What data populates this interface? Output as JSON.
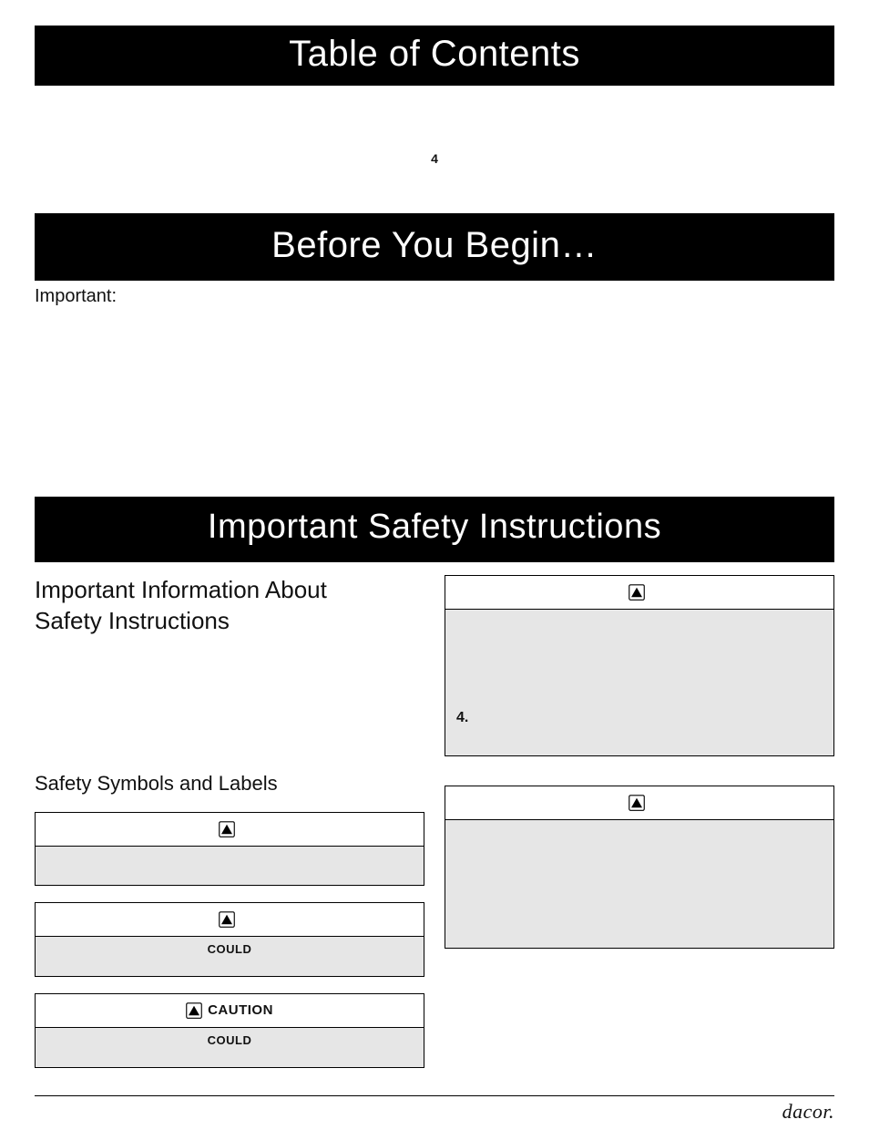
{
  "headers": {
    "toc": "Table of Contents",
    "before": "Before You Begin…",
    "safety": "Important Safety Instructions"
  },
  "toc_page_ref": "4",
  "before_important_label": "Important:",
  "left": {
    "info_heading_l1": "Important Information About",
    "info_heading_l2": "Safety Instructions",
    "symbols_heading": "Safety Symbols and Labels",
    "box1": {
      "header": "",
      "body": ""
    },
    "box2": {
      "header": "",
      "body": "COULD"
    },
    "box3": {
      "header": "CAUTION",
      "body": "COULD"
    }
  },
  "right": {
    "box1": {
      "header": "",
      "body_item_number": "4."
    },
    "box2": {
      "header": "",
      "body": ""
    }
  },
  "brand": "dacor."
}
